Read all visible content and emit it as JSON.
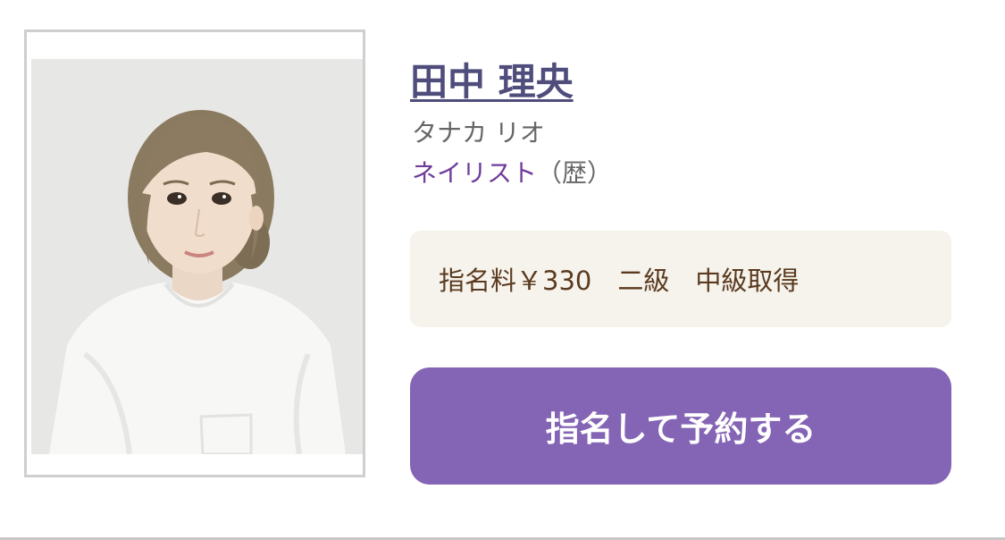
{
  "staff": {
    "name": "田中 理央",
    "kana": "タナカ リオ",
    "role": "ネイリスト",
    "role_note": "（歴）",
    "photo_alt": "田中 理央"
  },
  "info": {
    "text": "指名料￥330　二級　中級取得"
  },
  "actions": {
    "reserve_label": "指名して予約する"
  },
  "colors": {
    "name": "#4f4d7c",
    "role": "#6f3d98",
    "info_bg": "#f5f3ec",
    "info_text": "#5b3a1f",
    "button": "#8464b4"
  }
}
